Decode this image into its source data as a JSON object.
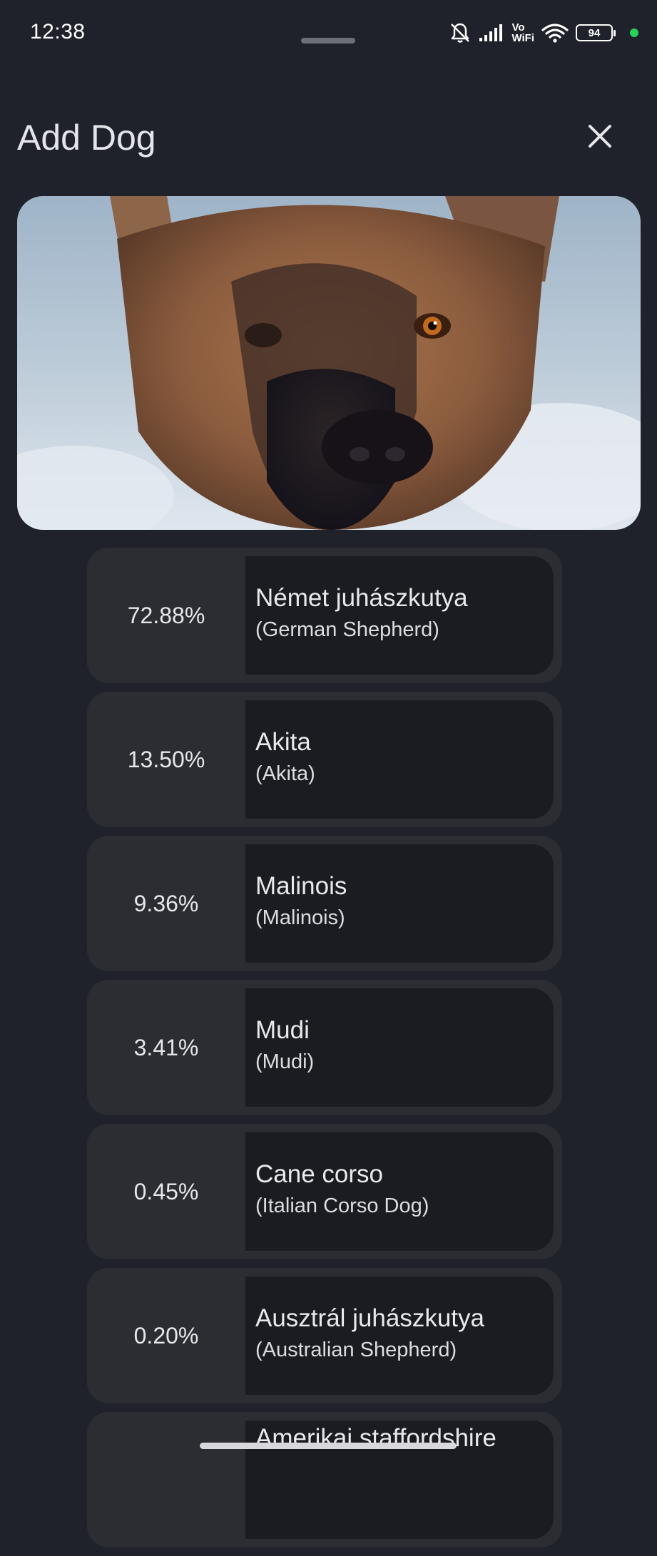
{
  "status_bar": {
    "time": "12:38",
    "vowifi_top": "Vo",
    "vowifi_bottom": "WiFi",
    "battery": "94",
    "icons": [
      "bell-off-icon",
      "signal-icon",
      "wifi-icon",
      "battery-icon"
    ]
  },
  "header": {
    "title": "Add Dog",
    "close_icon": "close-icon"
  },
  "photo": {
    "subject": "dog-photo"
  },
  "results": [
    {
      "percent": "72.88%",
      "name": "Német juhászkutya",
      "alt": "(German Shepherd)"
    },
    {
      "percent": "13.50%",
      "name": "Akita",
      "alt": "(Akita)"
    },
    {
      "percent": "9.36%",
      "name": "Malinois",
      "alt": "(Malinois)"
    },
    {
      "percent": "3.41%",
      "name": "Mudi",
      "alt": "(Mudi)"
    },
    {
      "percent": "0.45%",
      "name": "Cane corso",
      "alt": "(Italian Corso Dog)"
    },
    {
      "percent": "0.20%",
      "name": "Ausztrál juhászkutya",
      "alt": "(Australian Shepherd)"
    },
    {
      "percent": "",
      "name": "Amerikai staffordshire",
      "alt": ""
    }
  ],
  "colors": {
    "background": "#1f222a",
    "card": "#2c2d33",
    "name_panel": "#1b1c21",
    "status_dot": "#27d15b"
  }
}
